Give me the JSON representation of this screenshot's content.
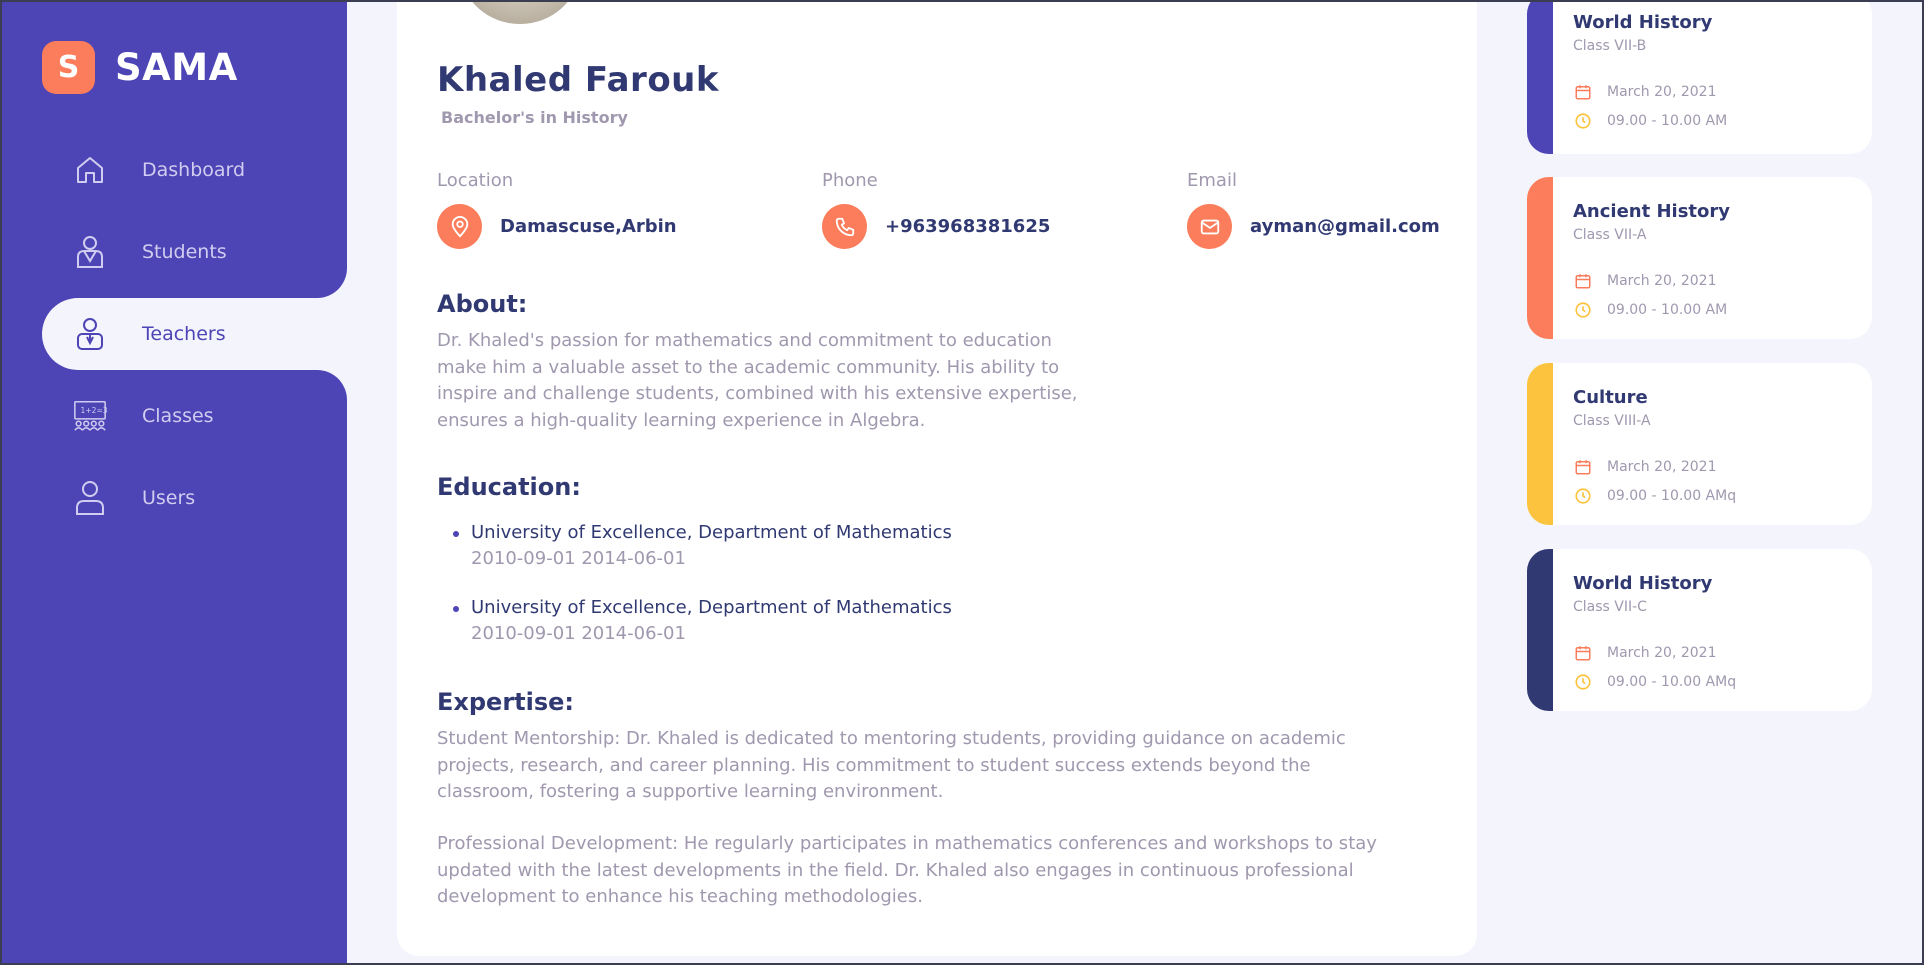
{
  "brand": {
    "badge": "S",
    "name": "SAMA"
  },
  "sidebar": {
    "items": [
      {
        "label": "Dashboard",
        "icon": "home-icon",
        "active": false
      },
      {
        "label": "Students",
        "icon": "student-icon",
        "active": false
      },
      {
        "label": "Teachers",
        "icon": "teacher-icon",
        "active": true
      },
      {
        "label": "Classes",
        "icon": "classroom-icon",
        "active": false
      },
      {
        "label": "Users",
        "icon": "user-icon",
        "active": false
      }
    ]
  },
  "profile": {
    "name": "Khaled  Farouk",
    "degree": "Bachelor's in History",
    "location": {
      "label": "Location",
      "value": "Damascuse,Arbin",
      "icon": "map-pin-icon"
    },
    "phone": {
      "label": "Phone",
      "value": "+963968381625",
      "icon": "phone-icon"
    },
    "email": {
      "label": "Email",
      "value": "ayman@gmail.com",
      "icon": "mail-icon"
    },
    "about": {
      "title": "About:",
      "lines": [
        "Dr. Khaled's passion for mathematics and commitment to education",
        "make him a valuable asset to the academic community. His ability to",
        "inspire and challenge students, combined with his extensive expertise,",
        "ensures a high-quality learning experience in Algebra."
      ]
    },
    "education": {
      "title": "Education:",
      "items": [
        {
          "title": "University of Excellence, Department of Mathematics",
          "dates": "2010-09-01 2014-06-01"
        },
        {
          "title": "University of Excellence, Department of Mathematics",
          "dates": "2010-09-01 2014-06-01"
        }
      ]
    },
    "expertise": {
      "title": "Expertise:",
      "para1": [
        "Student Mentorship: Dr. Khaled is dedicated to mentoring students, providing guidance on academic",
        "projects, research, and career planning. His commitment to student success extends beyond the",
        "classroom, fostering a supportive learning environment."
      ],
      "para2": [
        "Professional Development: He regularly participates in mathematics conferences and workshops to stay",
        "updated with the latest developments in the field. Dr. Khaled also engages in continuous professional",
        "development to enhance his teaching methodologies."
      ]
    }
  },
  "schedule": [
    {
      "title": "World History",
      "class": "Class VII-B",
      "date": "March 20, 2021",
      "time": "09.00 - 10.00 AM",
      "color": "#4d44b5"
    },
    {
      "title": "Ancient History",
      "class": "Class VII-A",
      "date": "March 20, 2021",
      "time": "09.00 - 10.00 AM",
      "color": "#fb7d5b"
    },
    {
      "title": "Culture",
      "class": "Class VIII-A",
      "date": "March 20, 2021",
      "time": "09.00 - 10.00 AMq",
      "color": "#fcc43e"
    },
    {
      "title": "World History",
      "class": "Class VII-C",
      "date": "March 20, 2021",
      "time": "09.00 - 10.00 AMq",
      "color": "#303972"
    }
  ],
  "colors": {
    "primary": "#4d44b5",
    "accent": "#fb7d5b",
    "yellow": "#fcc43e",
    "navy": "#303972",
    "muted": "#a098ae"
  }
}
